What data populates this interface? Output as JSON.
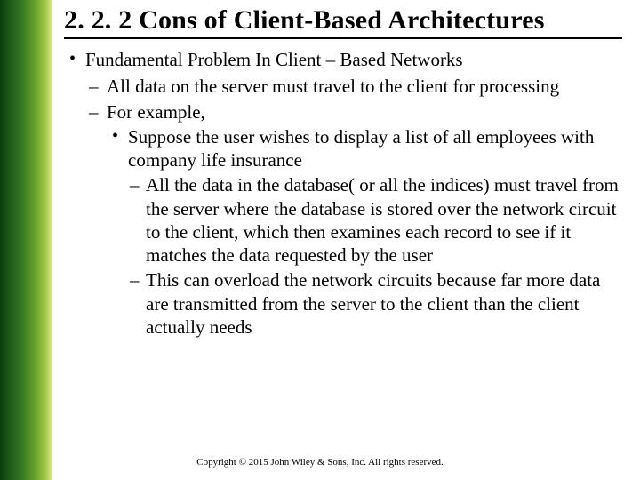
{
  "title": "2. 2. 2 Cons of Client-Based Architectures",
  "bullets": {
    "l1_0": "Fundamental Problem In Client – Based Networks",
    "l2_0": "All data on the server must travel to the client for processing",
    "l2_1": "For example,",
    "l3_0": "Suppose the user wishes to display a list of all employees with company life insurance",
    "l4_0": "All the data in the database( or all the indices) must travel from the server where the database is stored over the network circuit to the client, which then examines each record to see if it matches the data requested by the user",
    "l4_1": "This can overload the network circuits because far more data are transmitted from the server to the client than the client actually needs"
  },
  "footer": "Copyright © 2015 John Wiley & Sons, Inc. All rights reserved."
}
